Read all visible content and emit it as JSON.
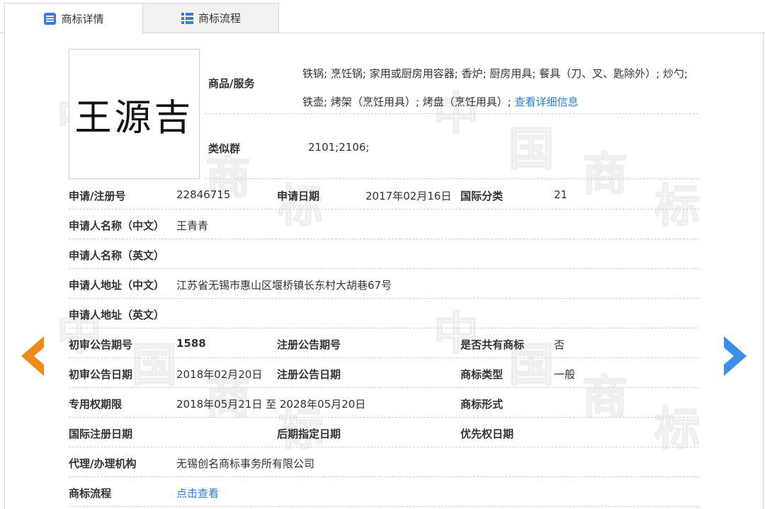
{
  "tabs": {
    "detail_label": "商标详情",
    "flow_label": "商标流程"
  },
  "watermark_chars": [
    "中",
    "国",
    "商",
    "标"
  ],
  "logo": {
    "text": "王源吉"
  },
  "goods": {
    "label": "商品/服务",
    "text": "铁锅; 烹饪锅; 家用或厨房用容器; 香炉; 厨房用具; 餐具（刀、叉、匙除外）; 炒勺; 铁壶; 烤架（烹饪用具）; 烤盘（烹饪用具）; ",
    "link": "查看详细信息"
  },
  "similar": {
    "label": "类似群",
    "value": "2101;2106;"
  },
  "rows": {
    "r1": {
      "l1": "申请/注册号",
      "v1": "22846715",
      "l2": "申请日期",
      "v2": "2017年02月16日",
      "l3": "国际分类",
      "v3": "21"
    },
    "r2": {
      "l1": "申请人名称（中文）",
      "v1": "王青青"
    },
    "r3": {
      "l1": "申请人名称（英文）",
      "v1": ""
    },
    "r4": {
      "l1": "申请人地址（中文）",
      "v1": "江苏省无锡市惠山区堰桥镇长东村大胡巷67号"
    },
    "r5": {
      "l1": "申请人地址（英文）",
      "v1": ""
    },
    "r6": {
      "l1": "初审公告期号",
      "v1": "1588",
      "l2": "注册公告期号",
      "v2": "",
      "l3": "是否共有商标",
      "v3": "否"
    },
    "r7": {
      "l1": "初审公告日期",
      "v1": "2018年02月20日",
      "l2": "注册公告日期",
      "v2": "",
      "l3": "商标类型",
      "v3": "一般"
    },
    "r8": {
      "l1": "专用权期限",
      "v1": "2018年05月21日 至 2028年05月20日",
      "l3": "商标形式",
      "v3": ""
    },
    "r9": {
      "l1": "国际注册日期",
      "v1": "",
      "l2": "后期指定日期",
      "v2": "",
      "l3": "优先权日期",
      "v3": ""
    },
    "r10": {
      "l1": "代理/办理机构",
      "v1": "无锡创名商标事务所有限公司"
    },
    "r11": {
      "l1": "商标流程",
      "v1": "点击查看"
    }
  },
  "colors": {
    "link": "#2b7fd3",
    "prev_arrow": "#f08a1c",
    "next_arrow": "#3a8ee6",
    "icon_blue": "#3a7bd5"
  },
  "icons": {
    "detail_tab": "list-icon",
    "flow_tab": "grid-list-icon",
    "prev": "chevron-left-icon",
    "next": "chevron-right-icon"
  }
}
